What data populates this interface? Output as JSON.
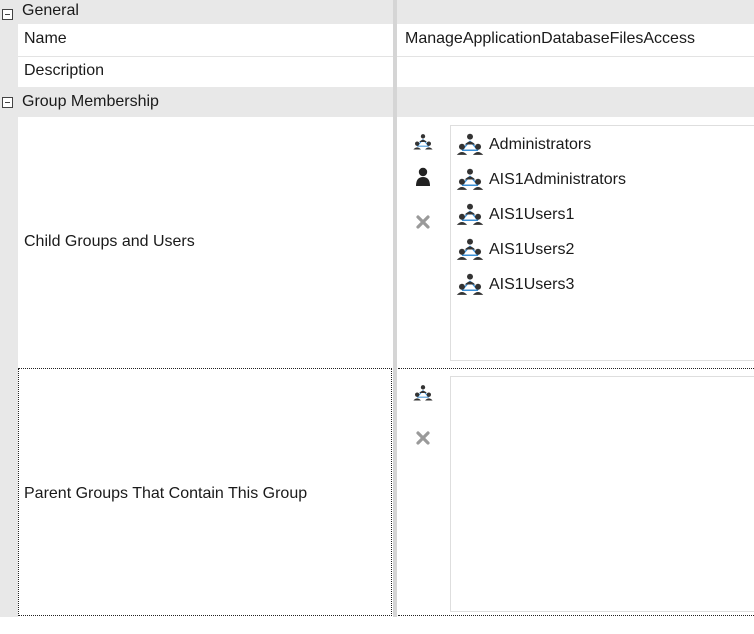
{
  "categories": {
    "general": "General",
    "group_membership": "Group Membership"
  },
  "properties": {
    "name_label": "Name",
    "name_value": "ManageApplicationDatabaseFilesAccess",
    "description_label": "Description",
    "description_value": "",
    "child_label": "Child Groups and Users",
    "parent_label": "Parent Groups That Contain This Group"
  },
  "child_members": [
    {
      "name": "Administrators",
      "icon": "group-icon"
    },
    {
      "name": "AIS1Administrators",
      "icon": "group-icon"
    },
    {
      "name": "AIS1Users1",
      "icon": "group-icon"
    },
    {
      "name": "AIS1Users2",
      "icon": "group-icon"
    },
    {
      "name": "AIS1Users3",
      "icon": "group-icon"
    }
  ],
  "parent_members": [],
  "colors": {
    "category_bg": "#e8e8e8",
    "icon_dark": "#333333",
    "icon_blue": "#3a8fd6",
    "remove_gray": "#9a9a9a"
  }
}
